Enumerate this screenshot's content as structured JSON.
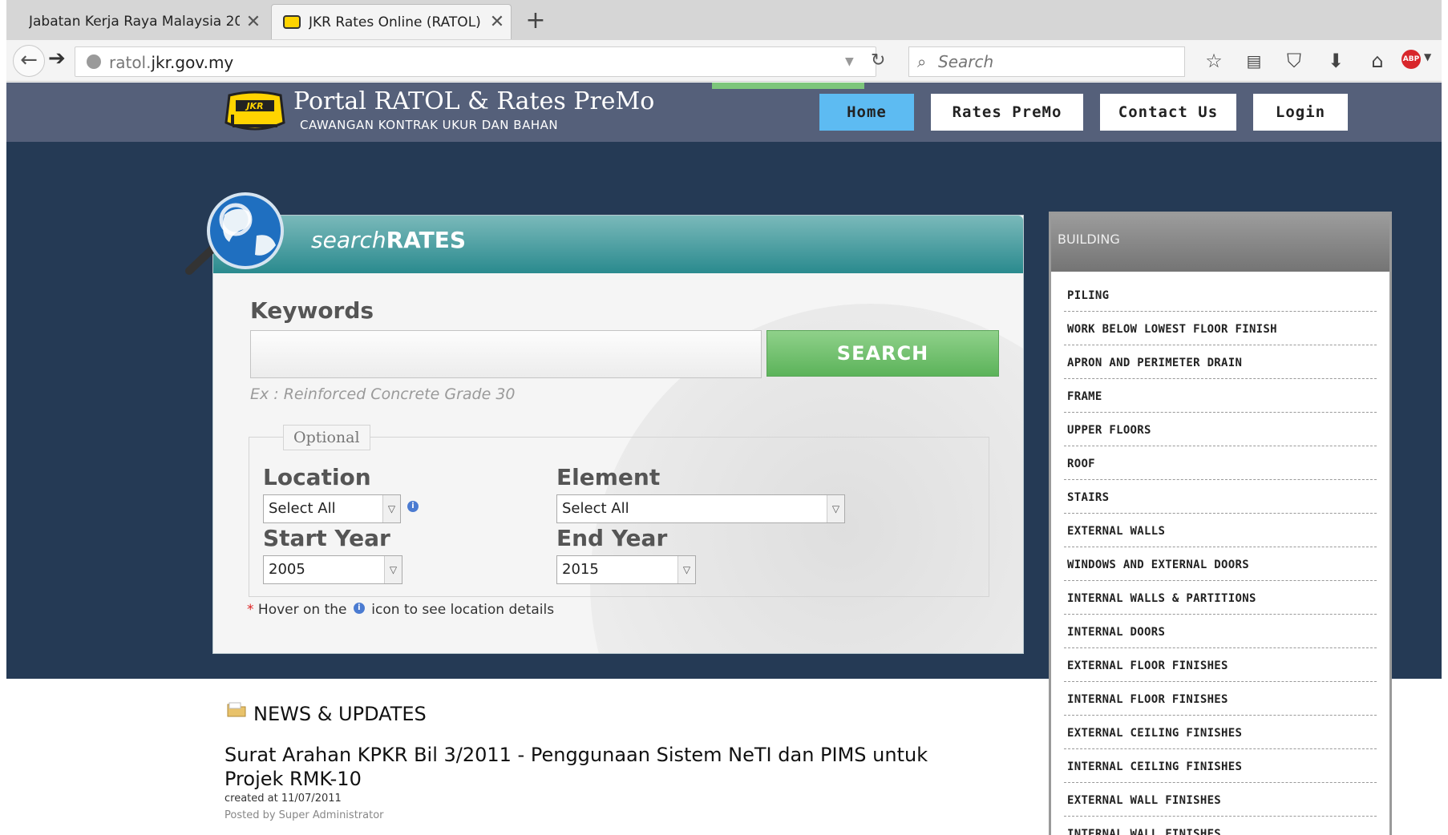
{
  "browser": {
    "tabs": [
      {
        "title": "Jabatan Kerja Raya Malaysia 20..."
      },
      {
        "title": "JKR Rates Online (RATOL)"
      }
    ],
    "url_host_prefix": "ratol.",
    "url_host_main": "jkr.gov.my",
    "search_placeholder": "Search"
  },
  "header": {
    "logo_text": "JKR",
    "title": "Portal RATOL & Rates PreMo",
    "subtitle": "CAWANGAN KONTRAK UKUR DAN BAHAN",
    "menu": [
      {
        "label": "Home"
      },
      {
        "label": "Rates PreMo"
      },
      {
        "label": "Contact Us"
      },
      {
        "label": "Login"
      }
    ]
  },
  "search_panel": {
    "title_italic": "search",
    "title_bold": "RATES",
    "keywords_label": "Keywords",
    "keywords_value": "",
    "search_button": "SEARCH",
    "example": "Ex : Reinforced Concrete Grade 30",
    "optional_legend": "Optional",
    "location_label": "Location",
    "location_value": "Select All",
    "element_label": "Element",
    "element_value": "Select All",
    "start_year_label": "Start Year",
    "start_year_value": "2005",
    "end_year_label": "End Year",
    "end_year_value": "2015",
    "note_prefix": "Hover on the",
    "note_suffix": "icon to see location details"
  },
  "sidebar": {
    "heading": "BUILDING",
    "items": [
      {
        "label": "PILING"
      },
      {
        "label": "WORK BELOW LOWEST FLOOR FINISH"
      },
      {
        "label": "APRON AND PERIMETER DRAIN"
      },
      {
        "label": "FRAME"
      },
      {
        "label": "UPPER FLOORS"
      },
      {
        "label": "ROOF"
      },
      {
        "label": "STAIRS"
      },
      {
        "label": "EXTERNAL WALLS"
      },
      {
        "label": "WINDOWS AND EXTERNAL DOORS"
      },
      {
        "label": "INTERNAL WALLS & PARTITIONS"
      },
      {
        "label": "INTERNAL DOORS"
      },
      {
        "label": "EXTERNAL FLOOR FINISHES"
      },
      {
        "label": "INTERNAL FLOOR FINISHES"
      },
      {
        "label": "EXTERNAL CEILING FINISHES"
      },
      {
        "label": "INTERNAL CEILING FINISHES"
      },
      {
        "label": "EXTERNAL WALL FINISHES"
      },
      {
        "label": "INTERNAL WALL FINISHES"
      }
    ]
  },
  "news": {
    "section_title": "NEWS & UPDATES",
    "headline": "Surat Arahan KPKR Bil 3/2011 - Penggunaan Sistem NeTI dan PIMS untuk Projek RMK-10",
    "created": "created at 11/07/2011",
    "posted_by": "Posted by Super Administrator"
  },
  "colors": {
    "header_bg": "#55607a",
    "band_bg": "#253a55",
    "active_menu": "#5dbbf2",
    "search_button": "#6cc068",
    "panel_head": "#3a9498"
  },
  "icons": [
    "back-arrow-icon",
    "forward-arrow-icon",
    "globe-icon",
    "reload-icon",
    "search-icon",
    "star-icon",
    "reading-list-icon",
    "pocket-icon",
    "download-icon",
    "home-icon",
    "adblock-icon",
    "magnifier-globe-icon",
    "info-icon",
    "news-folder-icon"
  ]
}
